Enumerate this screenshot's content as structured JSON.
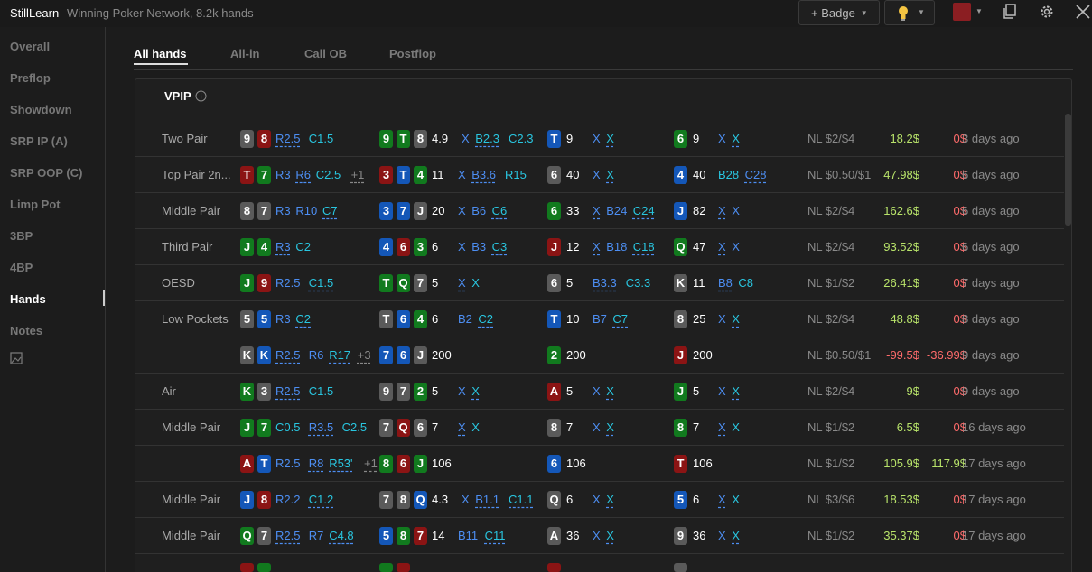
{
  "app": {
    "title": "StillLearn",
    "subtitle": "Winning Poker Network, 8.2k hands",
    "badge_label": "+ Badge"
  },
  "colors": {
    "accent_red": "#8b1e22",
    "spade": "#5a5a5a",
    "heart": "#8b1414",
    "diamond": "#1457b8",
    "club": "#117a1e",
    "call": "#29c6e0",
    "bet": "#4d8ef2",
    "positive": "#b8e36a",
    "negative": "#ff6b6b"
  },
  "icons": {
    "badge_chevron": "chevron-down-icon",
    "bulb": "lightbulb-icon",
    "copy": "copy-icon",
    "settings": "gear-icon",
    "close": "close-icon",
    "info": "info-icon",
    "image": "image-icon"
  },
  "sidebar": [
    {
      "label": "Overall"
    },
    {
      "label": "Preflop"
    },
    {
      "label": "Showdown"
    },
    {
      "label": "SRP IP (A)"
    },
    {
      "label": "SRP OOP (C)"
    },
    {
      "label": "Limp Pot"
    },
    {
      "label": "3BP"
    },
    {
      "label": "4BP"
    },
    {
      "label": "Hands",
      "active": true
    },
    {
      "label": "Notes"
    }
  ],
  "tabs": [
    {
      "label": "All hands",
      "active": true
    },
    {
      "label": "All-in"
    },
    {
      "label": "Call OB"
    },
    {
      "label": "Postflop"
    }
  ],
  "panel": {
    "title": "VPIP"
  },
  "hands": [
    {
      "label": "Two Pair",
      "hole": [
        [
          "9",
          "s"
        ],
        [
          "8",
          "h"
        ]
      ],
      "pre": [
        [
          "R2.5",
          "b",
          1
        ],
        [
          "C1.5",
          "c",
          0
        ]
      ],
      "flop": [
        [
          "9",
          "cl"
        ],
        [
          "T",
          "cl"
        ],
        [
          "8",
          "s"
        ]
      ],
      "flop_pot": "4.9",
      "flop_act": [
        [
          "X",
          "b",
          0
        ],
        [
          "B2.3",
          "c",
          1
        ],
        [
          "C2.3",
          "c",
          0
        ]
      ],
      "turn": [
        "T",
        "d"
      ],
      "turn_pot": "9",
      "turn_act": [
        [
          "X",
          "b",
          0
        ],
        [
          "X",
          "c",
          1
        ]
      ],
      "river": [
        "6",
        "cl"
      ],
      "river_pot": "9",
      "river_act": [
        [
          "X",
          "b",
          0
        ],
        [
          "X",
          "c",
          1
        ]
      ],
      "stakes": "NL $2/$4",
      "won": "18.2$",
      "ev": "0$",
      "when": "3 days ago"
    },
    {
      "label": "Top Pair 2n...",
      "hole": [
        [
          "T",
          "h"
        ],
        [
          "7",
          "cl"
        ]
      ],
      "pre": [
        [
          "R3",
          "b",
          0
        ],
        [
          "R6",
          "b",
          1
        ],
        [
          "C2.5",
          "c",
          0
        ]
      ],
      "pre_more": "+1",
      "flop": [
        [
          "3",
          "h"
        ],
        [
          "T",
          "d"
        ],
        [
          "4",
          "cl"
        ]
      ],
      "flop_pot": "11",
      "flop_act": [
        [
          "X",
          "b",
          0
        ],
        [
          "B3.6",
          "b",
          1
        ],
        [
          "R15",
          "c",
          0
        ]
      ],
      "turn": [
        "6",
        "s"
      ],
      "turn_pot": "40",
      "turn_act": [
        [
          "X",
          "b",
          0
        ],
        [
          "X",
          "c",
          1
        ]
      ],
      "river": [
        "4",
        "d"
      ],
      "river_pot": "40",
      "river_act": [
        [
          "B28",
          "c",
          0
        ],
        [
          "C28",
          "b",
          1
        ]
      ],
      "stakes": "NL $0.50/$1",
      "won": "47.98$",
      "ev": "0$",
      "when": "6 days ago"
    },
    {
      "label": "Middle Pair",
      "hole": [
        [
          "8",
          "s"
        ],
        [
          "7",
          "s"
        ]
      ],
      "pre": [
        [
          "R3",
          "b",
          0
        ],
        [
          "R10",
          "b",
          0
        ],
        [
          "C7",
          "c",
          1
        ]
      ],
      "flop": [
        [
          "3",
          "d"
        ],
        [
          "7",
          "d"
        ],
        [
          "J",
          "s"
        ]
      ],
      "flop_pot": "20",
      "flop_act": [
        [
          "X",
          "b",
          0
        ],
        [
          "B6",
          "b",
          0
        ],
        [
          "C6",
          "c",
          1
        ]
      ],
      "turn": [
        "6",
        "cl"
      ],
      "turn_pot": "33",
      "turn_act": [
        [
          "X",
          "b",
          1
        ],
        [
          "B24",
          "b",
          0
        ],
        [
          "C24",
          "c",
          1
        ]
      ],
      "river": [
        "J",
        "d"
      ],
      "river_pot": "82",
      "river_act": [
        [
          "X",
          "b",
          1
        ],
        [
          "X",
          "b",
          0
        ]
      ],
      "stakes": "NL $2/$4",
      "won": "162.6$",
      "ev": "0$",
      "when": "6 days ago"
    },
    {
      "label": "Third Pair",
      "hole": [
        [
          "J",
          "cl"
        ],
        [
          "4",
          "cl"
        ]
      ],
      "pre": [
        [
          "R3",
          "b",
          1
        ],
        [
          "C2",
          "c",
          0
        ]
      ],
      "flop": [
        [
          "4",
          "d"
        ],
        [
          "6",
          "h"
        ],
        [
          "3",
          "cl"
        ]
      ],
      "flop_pot": "6",
      "flop_act": [
        [
          "X",
          "b",
          0
        ],
        [
          "B3",
          "b",
          0
        ],
        [
          "C3",
          "c",
          1
        ]
      ],
      "turn": [
        "J",
        "h"
      ],
      "turn_pot": "12",
      "turn_act": [
        [
          "X",
          "b",
          1
        ],
        [
          "B18",
          "b",
          0
        ],
        [
          "C18",
          "c",
          1
        ]
      ],
      "river": [
        "Q",
        "cl"
      ],
      "river_pot": "47",
      "river_act": [
        [
          "X",
          "b",
          1
        ],
        [
          "X",
          "b",
          0
        ]
      ],
      "stakes": "NL $2/$4",
      "won": "93.52$",
      "ev": "0$",
      "when": "6 days ago"
    },
    {
      "label": "OESD",
      "hole": [
        [
          "J",
          "cl"
        ],
        [
          "9",
          "h"
        ]
      ],
      "pre": [
        [
          "R2.5",
          "b",
          0
        ],
        [
          "C1.5",
          "c",
          1
        ]
      ],
      "flop": [
        [
          "T",
          "cl"
        ],
        [
          "Q",
          "cl"
        ],
        [
          "7",
          "s"
        ]
      ],
      "flop_pot": "5",
      "flop_act": [
        [
          "X",
          "b",
          1
        ],
        [
          "X",
          "c",
          0
        ]
      ],
      "turn": [
        "6",
        "s"
      ],
      "turn_pot": "5",
      "turn_act": [
        [
          "B3.3",
          "b",
          1
        ],
        [
          "C3.3",
          "c",
          0
        ]
      ],
      "river": [
        "K",
        "s"
      ],
      "river_pot": "11",
      "river_act": [
        [
          "B8",
          "b",
          1
        ],
        [
          "C8",
          "c",
          0
        ]
      ],
      "stakes": "NL $1/$2",
      "won": "26.41$",
      "ev": "0$",
      "when": "7 days ago"
    },
    {
      "label": "Low Pockets",
      "hole": [
        [
          "5",
          "s"
        ],
        [
          "5",
          "d"
        ]
      ],
      "pre": [
        [
          "R3",
          "b",
          0
        ],
        [
          "C2",
          "c",
          1
        ]
      ],
      "flop": [
        [
          "T",
          "s"
        ],
        [
          "6",
          "d"
        ],
        [
          "4",
          "cl"
        ]
      ],
      "flop_pot": "6",
      "flop_act": [
        [
          "B2",
          "b",
          0
        ],
        [
          "C2",
          "c",
          1
        ]
      ],
      "turn": [
        "T",
        "d"
      ],
      "turn_pot": "10",
      "turn_act": [
        [
          "B7",
          "b",
          0
        ],
        [
          "C7",
          "c",
          1
        ]
      ],
      "river": [
        "8",
        "s"
      ],
      "river_pot": "25",
      "river_act": [
        [
          "X",
          "b",
          0
        ],
        [
          "X",
          "c",
          1
        ]
      ],
      "stakes": "NL $2/$4",
      "won": "48.8$",
      "ev": "0$",
      "when": "8 days ago"
    },
    {
      "label": "",
      "hole": [
        [
          "K",
          "s"
        ],
        [
          "K",
          "d"
        ]
      ],
      "pre": [
        [
          "R2.5",
          "b",
          1
        ],
        [
          "R6",
          "b",
          0
        ],
        [
          "R17",
          "c",
          1
        ]
      ],
      "pre_more": "+3",
      "flop": [
        [
          "7",
          "d"
        ],
        [
          "6",
          "d"
        ],
        [
          "J",
          "s"
        ]
      ],
      "flop_pot": "200",
      "flop_act": [],
      "turn": [
        "2",
        "cl"
      ],
      "turn_pot": "200",
      "turn_act": [],
      "river": [
        "J",
        "h"
      ],
      "river_pot": "200",
      "river_act": [],
      "stakes": "NL $0.50/$1",
      "won": "-99.5$",
      "won_neg": true,
      "ev": "-36.99$",
      "when": "9 days ago"
    },
    {
      "label": "Air",
      "hole": [
        [
          "K",
          "cl"
        ],
        [
          "3",
          "s"
        ]
      ],
      "pre": [
        [
          "R2.5",
          "b",
          1
        ],
        [
          "C1.5",
          "c",
          0
        ]
      ],
      "flop": [
        [
          "9",
          "s"
        ],
        [
          "7",
          "s"
        ],
        [
          "2",
          "cl"
        ]
      ],
      "flop_pot": "5",
      "flop_act": [
        [
          "X",
          "b",
          0
        ],
        [
          "X",
          "c",
          1
        ]
      ],
      "turn": [
        "A",
        "h"
      ],
      "turn_pot": "5",
      "turn_act": [
        [
          "X",
          "b",
          0
        ],
        [
          "X",
          "c",
          1
        ]
      ],
      "river": [
        "J",
        "cl"
      ],
      "river_pot": "5",
      "river_act": [
        [
          "X",
          "b",
          0
        ],
        [
          "X",
          "c",
          1
        ]
      ],
      "stakes": "NL $2/$4",
      "won": "9$",
      "ev": "0$",
      "when": "9 days ago"
    },
    {
      "label": "Middle Pair",
      "hole": [
        [
          "J",
          "cl"
        ],
        [
          "7",
          "cl"
        ]
      ],
      "pre": [
        [
          "C0.5",
          "c",
          0
        ],
        [
          "R3.5",
          "b",
          1
        ],
        [
          "C2.5",
          "c",
          0
        ]
      ],
      "flop": [
        [
          "7",
          "s"
        ],
        [
          "Q",
          "h"
        ],
        [
          "6",
          "s"
        ]
      ],
      "flop_pot": "7",
      "flop_act": [
        [
          "X",
          "b",
          1
        ],
        [
          "X",
          "c",
          0
        ]
      ],
      "turn": [
        "8",
        "s"
      ],
      "turn_pot": "7",
      "turn_act": [
        [
          "X",
          "b",
          0
        ],
        [
          "X",
          "c",
          1
        ]
      ],
      "river": [
        "8",
        "cl"
      ],
      "river_pot": "7",
      "river_act": [
        [
          "X",
          "b",
          1
        ],
        [
          "X",
          "c",
          0
        ]
      ],
      "stakes": "NL $1/$2",
      "won": "6.5$",
      "ev": "0$",
      "when": "16 days ago"
    },
    {
      "label": "",
      "hole": [
        [
          "A",
          "h"
        ],
        [
          "T",
          "d"
        ]
      ],
      "pre": [
        [
          "R2.5",
          "b",
          0
        ],
        [
          "R8",
          "b",
          1
        ],
        [
          "R53'",
          "c",
          1
        ]
      ],
      "pre_more": "+1",
      "flop": [
        [
          "8",
          "cl"
        ],
        [
          "6",
          "h"
        ],
        [
          "J",
          "cl"
        ]
      ],
      "flop_pot": "106",
      "flop_act": [],
      "turn": [
        "6",
        "d"
      ],
      "turn_pot": "106",
      "turn_act": [],
      "river": [
        "T",
        "h"
      ],
      "river_pot": "106",
      "river_act": [],
      "stakes": "NL $1/$2",
      "won": "105.9$",
      "ev": "117.9$",
      "ev_pos": true,
      "when": "17 days ago"
    },
    {
      "label": "Middle Pair",
      "hole": [
        [
          "J",
          "d"
        ],
        [
          "8",
          "h"
        ]
      ],
      "pre": [
        [
          "R2.2",
          "b",
          0
        ],
        [
          "C1.2",
          "c",
          1
        ]
      ],
      "flop": [
        [
          "7",
          "s"
        ],
        [
          "8",
          "s"
        ],
        [
          "Q",
          "d"
        ]
      ],
      "flop_pot": "4.3",
      "flop_act": [
        [
          "X",
          "b",
          0
        ],
        [
          "B1.1",
          "b",
          1
        ],
        [
          "C1.1",
          "c",
          1
        ]
      ],
      "turn": [
        "Q",
        "s"
      ],
      "turn_pot": "6",
      "turn_act": [
        [
          "X",
          "b",
          0
        ],
        [
          "X",
          "c",
          1
        ]
      ],
      "river": [
        "5",
        "d"
      ],
      "river_pot": "6",
      "river_act": [
        [
          "X",
          "b",
          1
        ],
        [
          "X",
          "c",
          0
        ]
      ],
      "stakes": "NL $3/$6",
      "won": "18.53$",
      "ev": "0$",
      "when": "17 days ago"
    },
    {
      "label": "Middle Pair",
      "hole": [
        [
          "Q",
          "cl"
        ],
        [
          "7",
          "s"
        ]
      ],
      "pre": [
        [
          "R2.5",
          "b",
          1
        ],
        [
          "R7",
          "b",
          0
        ],
        [
          "C4.8",
          "c",
          1
        ]
      ],
      "flop": [
        [
          "5",
          "d"
        ],
        [
          "8",
          "cl"
        ],
        [
          "7",
          "h"
        ]
      ],
      "flop_pot": "14",
      "flop_act": [
        [
          "B11",
          "b",
          0
        ],
        [
          "C11",
          "c",
          1
        ]
      ],
      "turn": [
        "A",
        "s"
      ],
      "turn_pot": "36",
      "turn_act": [
        [
          "X",
          "b",
          0
        ],
        [
          "X",
          "c",
          1
        ]
      ],
      "river": [
        "9",
        "s"
      ],
      "river_pot": "36",
      "river_act": [
        [
          "X",
          "b",
          0
        ],
        [
          "X",
          "c",
          1
        ]
      ],
      "stakes": "NL $1/$2",
      "won": "35.37$",
      "ev": "0$",
      "when": "17 days ago"
    }
  ]
}
